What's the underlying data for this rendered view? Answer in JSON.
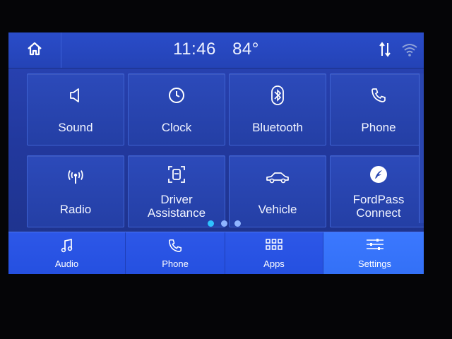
{
  "status": {
    "time": "11:46",
    "temperature": "84°",
    "icons": [
      "home-icon",
      "sort-arrows-icon",
      "wifi-icon"
    ]
  },
  "grid": {
    "tiles": [
      {
        "label_lines": [
          "Sound"
        ],
        "icon": "speaker-icon"
      },
      {
        "label_lines": [
          "Clock"
        ],
        "icon": "clock-icon"
      },
      {
        "label_lines": [
          "Bluetooth"
        ],
        "icon": "bluetooth-icon"
      },
      {
        "label_lines": [
          "Phone"
        ],
        "icon": "phone-icon"
      },
      {
        "label_lines": [
          "Radio"
        ],
        "icon": "radio-signal-icon"
      },
      {
        "label_lines": [
          "Driver",
          "Assistance"
        ],
        "icon": "driver-assist-icon"
      },
      {
        "label_lines": [
          "Vehicle"
        ],
        "icon": "car-icon"
      },
      {
        "label_lines": [
          "FordPass",
          "Connect"
        ],
        "icon": "fordpass-icon"
      }
    ],
    "pager": {
      "pages": 3,
      "active_page": 1
    }
  },
  "bottom_nav": {
    "items": [
      {
        "label": "Audio",
        "icon": "music-note-icon"
      },
      {
        "label": "Phone",
        "icon": "phone-icon"
      },
      {
        "label": "Apps",
        "icon": "apps-grid-icon"
      },
      {
        "label": "Settings",
        "icon": "sliders-icon",
        "active": true
      }
    ]
  },
  "colors": {
    "accent": "#2fc3ff",
    "bar_blue": "#2550e0",
    "active_tab": "#3370f6"
  }
}
